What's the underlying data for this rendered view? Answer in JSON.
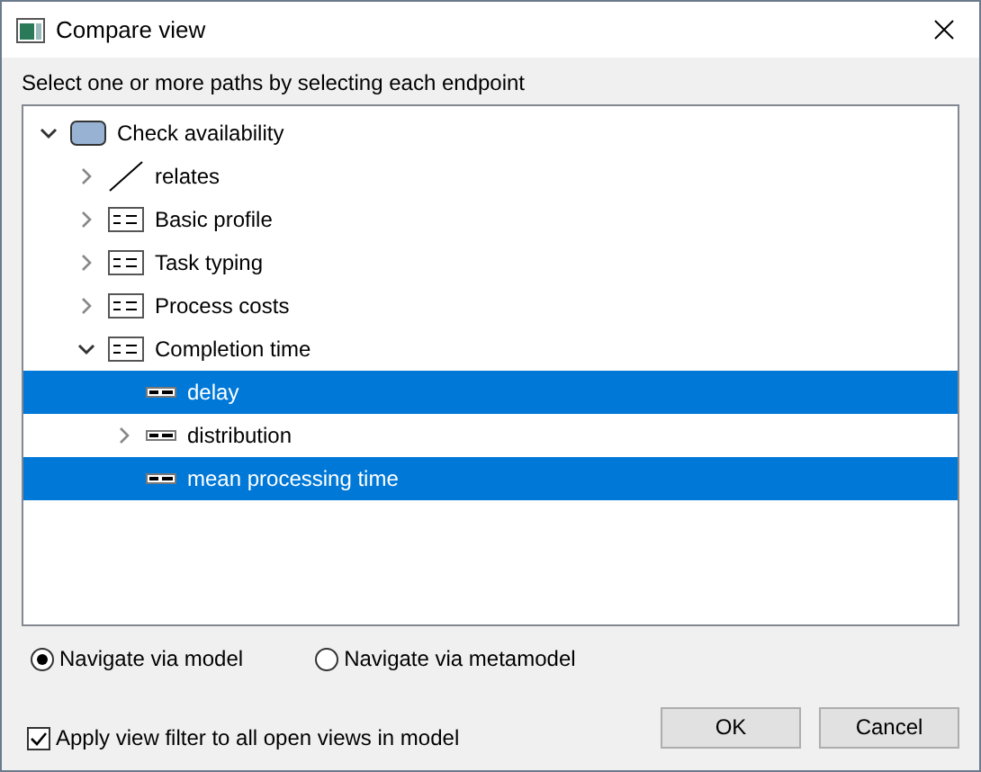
{
  "window": {
    "title": "Compare view"
  },
  "instruction": "Select one or more paths by selecting each endpoint",
  "tree": [
    {
      "label": "Check availability",
      "kind": "model",
      "expandable": true,
      "expanded": true,
      "selected": false,
      "children": [
        {
          "label": "relates",
          "kind": "relation",
          "expandable": true,
          "expanded": false,
          "selected": false
        },
        {
          "label": "Basic profile",
          "kind": "object",
          "expandable": true,
          "expanded": false,
          "selected": false
        },
        {
          "label": "Task typing",
          "kind": "object",
          "expandable": true,
          "expanded": false,
          "selected": false
        },
        {
          "label": "Process costs",
          "kind": "object",
          "expandable": true,
          "expanded": false,
          "selected": false
        },
        {
          "label": "Completion time",
          "kind": "object",
          "expandable": true,
          "expanded": true,
          "selected": false,
          "children": [
            {
              "label": "delay",
              "kind": "attribute",
              "expandable": false,
              "expanded": false,
              "selected": true
            },
            {
              "label": "distribution",
              "kind": "attribute",
              "expandable": true,
              "expanded": false,
              "selected": false
            },
            {
              "label": "mean processing time",
              "kind": "attribute",
              "expandable": false,
              "expanded": false,
              "selected": true
            }
          ]
        }
      ]
    }
  ],
  "navigation": [
    {
      "label": "Navigate via model",
      "selected": true
    },
    {
      "label": "Navigate via metamodel",
      "selected": false
    }
  ],
  "filter_option": {
    "label": "Apply view filter to all open views in model",
    "checked": true
  },
  "buttons": [
    "OK",
    "Cancel"
  ]
}
